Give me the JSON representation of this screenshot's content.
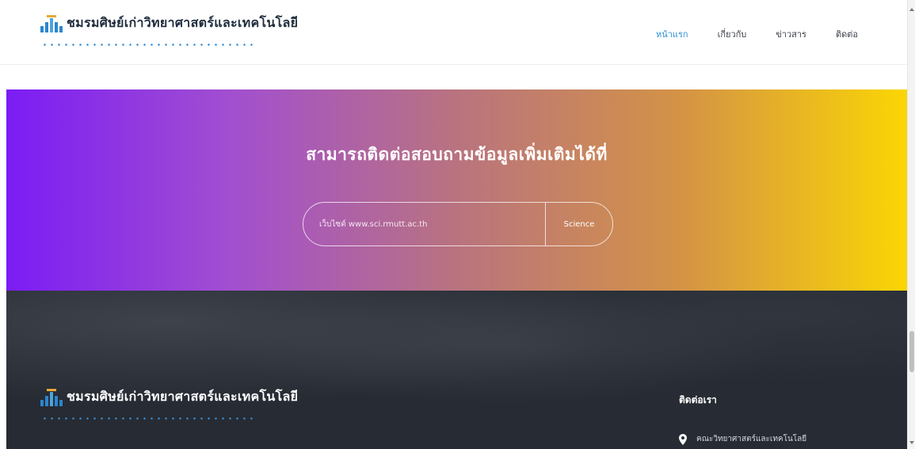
{
  "header": {
    "logo": {
      "title": "ชมรมศิษย์เก่าวิทยาศาสตร์และเทคโนโลยี",
      "icon": "building-columns-icon"
    },
    "nav": [
      {
        "label": "หน้าแรก",
        "active": true
      },
      {
        "label": "เกี่ยวกับ",
        "active": false
      },
      {
        "label": "ข่าวสาร",
        "active": false
      },
      {
        "label": "ติดต่อ",
        "active": false
      }
    ]
  },
  "contact_banner": {
    "title": "สามารถติดต่อสอบถามข้อมูลเพิ่มเติมได้ที่",
    "search": {
      "placeholder": "เว็บไซต์ www.sci.rmutt.ac.th",
      "button_label": "Science"
    },
    "gradient_colors": [
      "#7b1cf5",
      "#fbd604"
    ]
  },
  "footer": {
    "logo": {
      "title": "ชมรมศิษย์เก่าวิทยาศาสตร์และเทคโนโลยี",
      "icon": "building-columns-icon"
    },
    "contact": {
      "heading": "ติดต่อเรา",
      "address_icon": "map-pin-icon",
      "address": "คณะวิทยาศาสตร์และเทคโนโลยี"
    },
    "background_color": "#272b33"
  },
  "colors": {
    "accent": "#2e8fd8",
    "text_dark": "#1f2d3d"
  }
}
